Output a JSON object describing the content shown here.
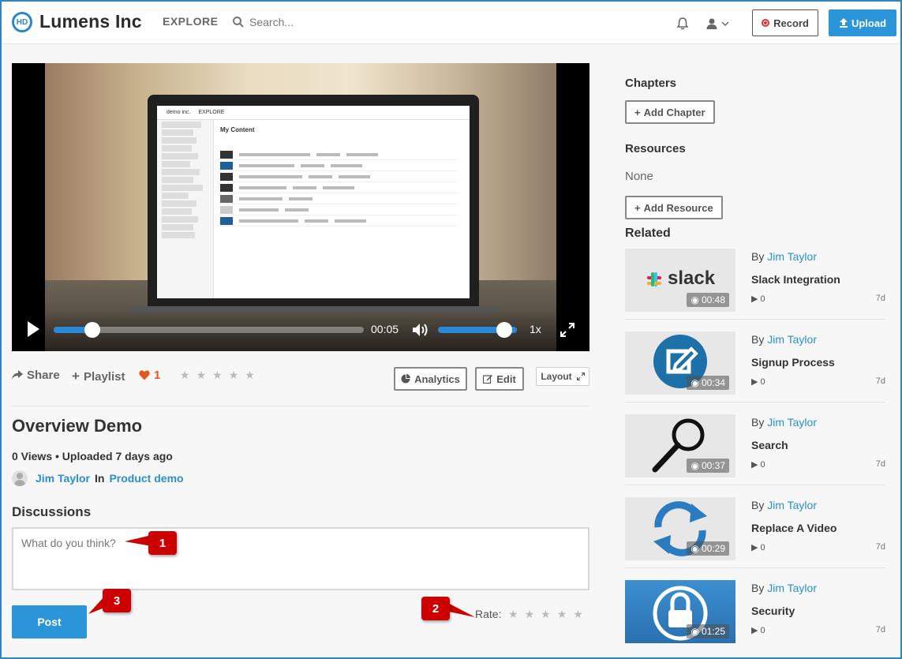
{
  "header": {
    "logo_text": "HD",
    "brand": "Lumens Inc",
    "explore": "EXPLORE",
    "search_placeholder": "Search...",
    "record": "Record",
    "upload": "Upload"
  },
  "video": {
    "time": "00:05",
    "speed": "1x",
    "progress_fraction": 0.1,
    "volume_fraction": 0.9,
    "screen_logo": "demo inc.",
    "screen_explore": "EXPLORE",
    "screen_title": "My Content"
  },
  "actions": {
    "share": "Share",
    "playlist": "Playlist",
    "likes": "1",
    "analytics": "Analytics",
    "edit": "Edit",
    "layout": "Layout"
  },
  "details": {
    "title": "Overview Demo",
    "meta": "0 Views • Uploaded 7 days ago",
    "owner": "Jim Taylor",
    "in_label": "In",
    "category": "Product demo"
  },
  "discussion": {
    "heading": "Discussions",
    "placeholder": "What do you think?",
    "post": "Post",
    "rate_label": "Rate:"
  },
  "callouts": [
    "1",
    "2",
    "3"
  ],
  "sidebar": {
    "chapters_heading": "Chapters",
    "add_chapter": "Add Chapter",
    "resources_heading": "Resources",
    "resources_none": "None",
    "add_resource": "Add Resource",
    "related_heading": "Related",
    "related": [
      {
        "by": "By",
        "author": "Jim Taylor",
        "title": "Slack Integration",
        "duration": "00:48",
        "views": "0",
        "age": "7d",
        "thumb_text": "slack",
        "thumb": "slack-logo-icon"
      },
      {
        "by": "By",
        "author": "Jim Taylor",
        "title": "Signup Process",
        "duration": "00:34",
        "views": "0",
        "age": "7d",
        "thumb": "edit-icon"
      },
      {
        "by": "By",
        "author": "Jim Taylor",
        "title": "Search",
        "duration": "00:37",
        "views": "0",
        "age": "7d",
        "thumb": "magnifier-icon"
      },
      {
        "by": "By",
        "author": "Jim Taylor",
        "title": "Replace A Video",
        "duration": "00:29",
        "views": "0",
        "age": "7d",
        "thumb": "refresh-icon"
      },
      {
        "by": "By",
        "author": "Jim Taylor",
        "title": "Security",
        "duration": "01:25",
        "views": "0",
        "age": "7d",
        "thumb": "lock-icon"
      }
    ]
  },
  "colors": {
    "accent": "#2b95d9",
    "link": "#2a8fd0",
    "callout": "#cc0000",
    "heart": "#e2581e"
  }
}
